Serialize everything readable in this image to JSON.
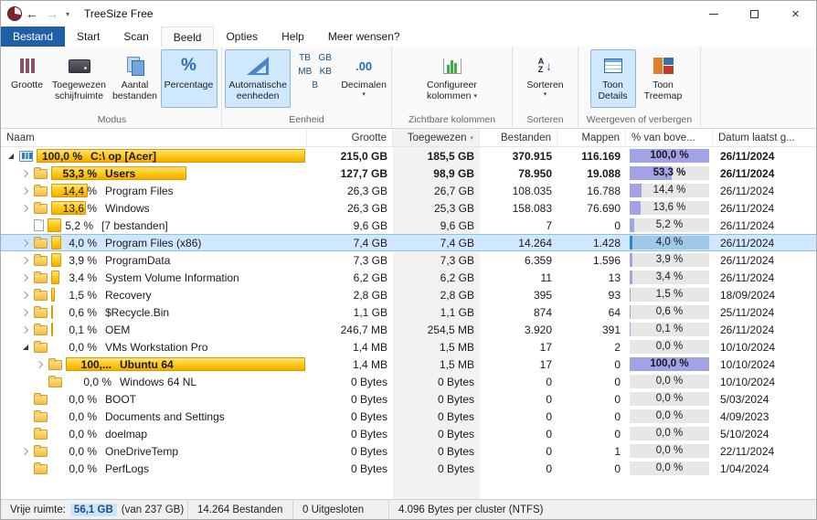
{
  "window": {
    "title": "TreeSize Free"
  },
  "icons": {
    "back": "←",
    "forward": "→",
    "caret": "▾",
    "close": "×",
    "percent": "%",
    "decimals": ".00",
    "sort_a": "A",
    "sort_z": "Z",
    "sort_arrow": "↓",
    "header_sort": "▾",
    "dropdown": "▾"
  },
  "tabs": [
    {
      "label": "Bestand"
    },
    {
      "label": "Start"
    },
    {
      "label": "Scan"
    },
    {
      "label": "Beeld"
    },
    {
      "label": "Opties"
    },
    {
      "label": "Help"
    },
    {
      "label": "Meer wensen?"
    }
  ],
  "ribbon": {
    "modus": {
      "label": "Modus",
      "grootte": {
        "l1": "Grootte",
        "l2": ""
      },
      "toegewezen": {
        "l1": "Toegewezen",
        "l2": "schijfruimte"
      },
      "aantal": {
        "l1": "Aantal",
        "l2": "bestanden"
      },
      "percentage": {
        "l1": "Percentage",
        "l2": ""
      }
    },
    "eenheid": {
      "label": "Eenheid",
      "auto": {
        "l1": "Automatische",
        "l2": "eenheden"
      },
      "units": [
        "TB",
        "GB",
        "MB",
        "KB",
        "B"
      ],
      "decimalen": {
        "l1": "Decimalen"
      }
    },
    "kolommen": {
      "label": "Zichtbare kolommen",
      "configureer": {
        "l1": "Configureer",
        "l2": "kolommen"
      }
    },
    "sorteren": {
      "label": "Sorteren",
      "btn": {
        "l1": "Sorteren"
      }
    },
    "weergeven": {
      "label": "Weergeven of verbergen",
      "details": {
        "l1": "Toon",
        "l2": "Details"
      },
      "treemap": {
        "l1": "Toon",
        "l2": "Treemap"
      }
    }
  },
  "tree": {
    "columns": [
      "Naam",
      "Grootte",
      "Toegewezen",
      "Bestanden",
      "Mappen",
      "% van bove...",
      "Datum laatst g..."
    ],
    "rows": [
      {
        "level": 0,
        "exp": "open",
        "icon": "drive",
        "pct": "100,0 %",
        "barPct": 100,
        "name": "C:\\ op  [Acer]",
        "size": "215,0 GB",
        "alloc": "185,5 GB",
        "files": "370.915",
        "folders": "116.169",
        "pcol": "100,0 %",
        "pcolPct": 100,
        "date": "26/11/2024",
        "bold": true
      },
      {
        "level": 1,
        "exp": "closed",
        "icon": "folder",
        "pct": "53,3 %",
        "barPct": 53.3,
        "name": "Users",
        "size": "127,7 GB",
        "alloc": "98,9 GB",
        "files": "78.950",
        "folders": "19.088",
        "pcol": "53,3 %",
        "pcolPct": 53.3,
        "date": "26/11/2024",
        "bold": true
      },
      {
        "level": 1,
        "exp": "closed",
        "icon": "folder",
        "pct": "14,4 %",
        "barPct": 14.4,
        "name": "Program Files",
        "size": "26,3 GB",
        "alloc": "26,7 GB",
        "files": "108.035",
        "folders": "16.788",
        "pcol": "14,4 %",
        "pcolPct": 14.4,
        "date": "26/11/2024"
      },
      {
        "level": 1,
        "exp": "closed",
        "icon": "folder",
        "pct": "13,6 %",
        "barPct": 13.6,
        "name": "Windows",
        "size": "26,3 GB",
        "alloc": "25,3 GB",
        "files": "158.083",
        "folders": "76.690",
        "pcol": "13,6 %",
        "pcolPct": 13.6,
        "date": "26/11/2024"
      },
      {
        "level": 1,
        "exp": "none",
        "icon": "file",
        "pct": "5,2 %",
        "barPct": 5.2,
        "name": "[7 bestanden]",
        "size": "9,6 GB",
        "alloc": "9,6 GB",
        "files": "7",
        "folders": "0",
        "pcol": "5,2 %",
        "pcolPct": 5.2,
        "date": "26/11/2024"
      },
      {
        "level": 1,
        "exp": "closed",
        "icon": "folder",
        "pct": "4,0 %",
        "barPct": 4,
        "name": "Program Files (x86)",
        "size": "7,4 GB",
        "alloc": "7,4 GB",
        "files": "14.264",
        "folders": "1.428",
        "pcol": "4,0 %",
        "pcolPct": 4,
        "date": "26/11/2024",
        "selected": true
      },
      {
        "level": 1,
        "exp": "closed",
        "icon": "folder",
        "pct": "3,9 %",
        "barPct": 3.9,
        "name": "ProgramData",
        "size": "7,3 GB",
        "alloc": "7,3 GB",
        "files": "6.359",
        "folders": "1.596",
        "pcol": "3,9 %",
        "pcolPct": 3.9,
        "date": "26/11/2024"
      },
      {
        "level": 1,
        "exp": "closed",
        "icon": "folder",
        "pct": "3,4 %",
        "barPct": 3.4,
        "name": "System Volume Information",
        "size": "6,2 GB",
        "alloc": "6,2 GB",
        "files": "11",
        "folders": "13",
        "pcol": "3,4 %",
        "pcolPct": 3.4,
        "date": "26/11/2024"
      },
      {
        "level": 1,
        "exp": "closed",
        "icon": "folder",
        "pct": "1,5 %",
        "barPct": 1.5,
        "name": "Recovery",
        "size": "2,8 GB",
        "alloc": "2,8 GB",
        "files": "395",
        "folders": "93",
        "pcol": "1,5 %",
        "pcolPct": 1.5,
        "date": "18/09/2024"
      },
      {
        "level": 1,
        "exp": "closed",
        "icon": "folder",
        "pct": "0,6 %",
        "barPct": 0.6,
        "name": "$Recycle.Bin",
        "size": "1,1 GB",
        "alloc": "1,1 GB",
        "files": "874",
        "folders": "64",
        "pcol": "0,6 %",
        "pcolPct": 0.6,
        "date": "25/11/2024"
      },
      {
        "level": 1,
        "exp": "closed",
        "icon": "folder",
        "pct": "0,1 %",
        "barPct": 0.1,
        "name": "OEM",
        "size": "246,7 MB",
        "alloc": "254,5 MB",
        "files": "3.920",
        "folders": "391",
        "pcol": "0,1 %",
        "pcolPct": 0.1,
        "date": "26/11/2024"
      },
      {
        "level": 1,
        "exp": "open",
        "icon": "folder",
        "pct": "0,0 %",
        "barPct": 0,
        "name": "VMs Workstation Pro",
        "size": "1,4 MB",
        "alloc": "1,5 MB",
        "files": "17",
        "folders": "2",
        "pcol": "0,0 %",
        "pcolPct": 0,
        "date": "10/10/2024"
      },
      {
        "level": 2,
        "exp": "closed",
        "icon": "folder",
        "pct": "100,...",
        "barPct": 100,
        "name": "Ubuntu 64",
        "size": "1,4 MB",
        "alloc": "1,5 MB",
        "files": "17",
        "folders": "0",
        "pcol": "100,0 %",
        "pcolPct": 100,
        "date": "10/10/2024",
        "nameBold": true
      },
      {
        "level": 2,
        "exp": "none",
        "icon": "folder",
        "pct": "0,0 %",
        "barPct": 0,
        "name": "Windows 64 NL",
        "size": "0 Bytes",
        "alloc": "0 Bytes",
        "files": "0",
        "folders": "0",
        "pcol": "0,0 %",
        "pcolPct": 0,
        "date": "10/10/2024"
      },
      {
        "level": 1,
        "exp": "none",
        "icon": "folder",
        "pct": "0,0 %",
        "barPct": 0,
        "name": "BOOT",
        "size": "0 Bytes",
        "alloc": "0 Bytes",
        "files": "0",
        "folders": "0",
        "pcol": "0,0 %",
        "pcolPct": 0,
        "date": "5/03/2024"
      },
      {
        "level": 1,
        "exp": "none",
        "icon": "folder",
        "pct": "0,0 %",
        "barPct": 0,
        "name": "Documents and Settings",
        "size": "0 Bytes",
        "alloc": "0 Bytes",
        "files": "0",
        "folders": "0",
        "pcol": "0,0 %",
        "pcolPct": 0,
        "date": "4/09/2023"
      },
      {
        "level": 1,
        "exp": "none",
        "icon": "folder",
        "pct": "0,0 %",
        "barPct": 0,
        "name": "doelmap",
        "size": "0 Bytes",
        "alloc": "0 Bytes",
        "files": "0",
        "folders": "0",
        "pcol": "0,0 %",
        "pcolPct": 0,
        "date": "5/10/2024"
      },
      {
        "level": 1,
        "exp": "closed",
        "icon": "folder",
        "pct": "0,0 %",
        "barPct": 0,
        "name": "OneDriveTemp",
        "size": "0 Bytes",
        "alloc": "0 Bytes",
        "files": "0",
        "folders": "1",
        "pcol": "0,0 %",
        "pcolPct": 0,
        "date": "22/11/2024"
      },
      {
        "level": 1,
        "exp": "none",
        "icon": "folder",
        "pct": "0,0 %",
        "barPct": 0,
        "name": "PerfLogs",
        "size": "0 Bytes",
        "alloc": "0 Bytes",
        "files": "0",
        "folders": "0",
        "pcol": "0,0 %",
        "pcolPct": 0,
        "date": "1/04/2024"
      }
    ]
  },
  "status": {
    "free_label": "Vrije ruimte:",
    "free_value": "56,1 GB",
    "free_total": "(van 237 GB)",
    "files": "14.264 Bestanden",
    "excluded": "0 Uitgesloten",
    "cluster": "4.096 Bytes per cluster (NTFS)"
  },
  "colors": {
    "accent_blue": "#1e5fa8",
    "selection": "#cfe8ff",
    "bar_gold": "#fdc30a",
    "percent_fill": "#a2a2e6",
    "percent_fill_selected": "#2f86d4"
  }
}
